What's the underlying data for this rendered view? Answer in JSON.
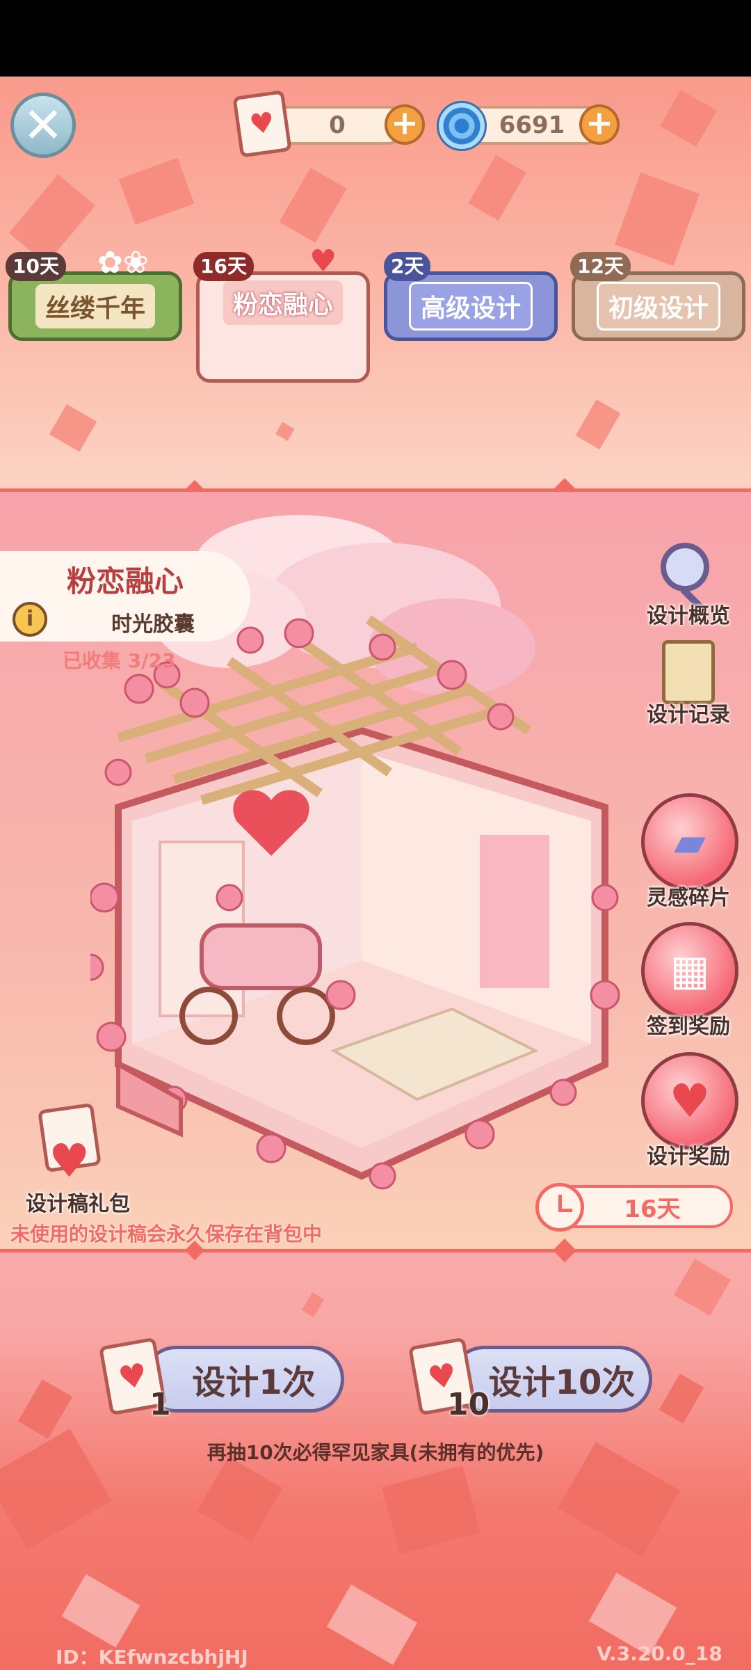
{
  "top_bar": {
    "close_icon": "close-x-icon",
    "tickets": {
      "icon": "heart-ticket-icon",
      "value": "0"
    },
    "crystals": {
      "icon": "blue-swirl-icon",
      "value": "6691"
    }
  },
  "tabs": [
    {
      "days": "10天",
      "label": "丝缕千年",
      "style": "green"
    },
    {
      "days": "16天",
      "label": "粉恋融心",
      "style": "pink",
      "selected": true
    },
    {
      "days": "2天",
      "label": "高级设计",
      "style": "blue"
    },
    {
      "days": "12天",
      "label": "初级设计",
      "style": "beige"
    }
  ],
  "featured": {
    "title": "粉恋融心",
    "subtitle": "时光胶囊",
    "collected": "已收集 3/23"
  },
  "right_menu": {
    "overview": "设计概览",
    "records": "设计记录",
    "fragments": "灵感碎片",
    "checkin": "签到奖励",
    "rewards": "设计奖励"
  },
  "gift_pack": {
    "label": "设计稿礼包",
    "note": "未使用的设计稿会永久保存在背包中"
  },
  "timer": "16天",
  "draw": {
    "single": {
      "count": "1",
      "label": "设计1次"
    },
    "ten": {
      "count": "10",
      "label": "设计10次"
    },
    "guarantee": "再抽10次必得罕见家具(未拥有的优先)"
  },
  "footer": {
    "id": "ID：KEfwnzcbhjHJ",
    "version": "V.3.20.0_18"
  },
  "colors": {
    "accent_red": "#f26a62",
    "title_red": "#b73f40",
    "background_pink": "#f7a6ab"
  }
}
